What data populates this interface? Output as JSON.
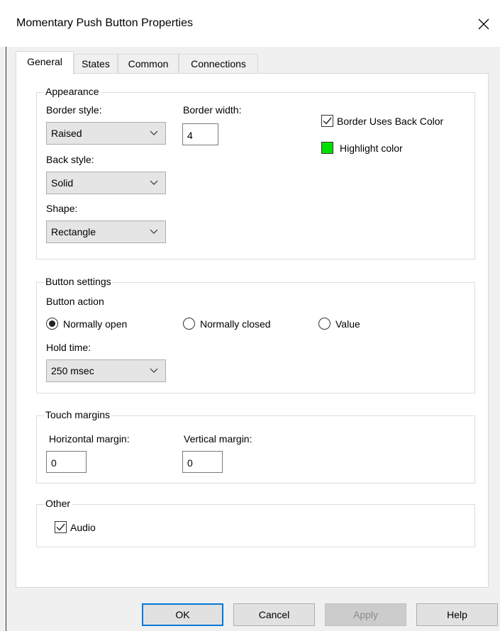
{
  "window": {
    "title": "Momentary Push Button Properties",
    "close_icon": "close-icon"
  },
  "tabs": [
    {
      "label": "General",
      "active": true
    },
    {
      "label": "States",
      "active": false
    },
    {
      "label": "Common",
      "active": false
    },
    {
      "label": "Connections",
      "active": false
    }
  ],
  "appearance": {
    "title": "Appearance",
    "border_style_label": "Border style:",
    "border_style_value": "Raised",
    "border_width_label": "Border width:",
    "border_width_value": "4",
    "border_uses_back_color_label": "Border Uses Back Color",
    "border_uses_back_color_checked": true,
    "highlight_color_label": "Highlight color",
    "highlight_color": "#00e000",
    "back_style_label": "Back style:",
    "back_style_value": "Solid",
    "shape_label": "Shape:",
    "shape_value": "Rectangle"
  },
  "button_settings": {
    "title": "Button settings",
    "action_label": "Button action",
    "options": [
      {
        "label": "Normally open",
        "selected": true
      },
      {
        "label": "Normally closed",
        "selected": false
      },
      {
        "label": "Value",
        "selected": false
      }
    ],
    "hold_time_label": "Hold time:",
    "hold_time_value": "250 msec"
  },
  "touch_margins": {
    "title": "Touch margins",
    "horizontal_label": "Horizontal margin:",
    "horizontal_value": "0",
    "vertical_label": "Vertical margin:",
    "vertical_value": "0"
  },
  "other": {
    "title": "Other",
    "audio_label": "Audio",
    "audio_checked": true
  },
  "buttons": {
    "ok": "OK",
    "cancel": "Cancel",
    "apply": "Apply",
    "help": "Help"
  },
  "colors": {
    "accent": "#0078d7",
    "dialog_bg": "#f0f0f0",
    "panel_bg": "#ffffff"
  }
}
